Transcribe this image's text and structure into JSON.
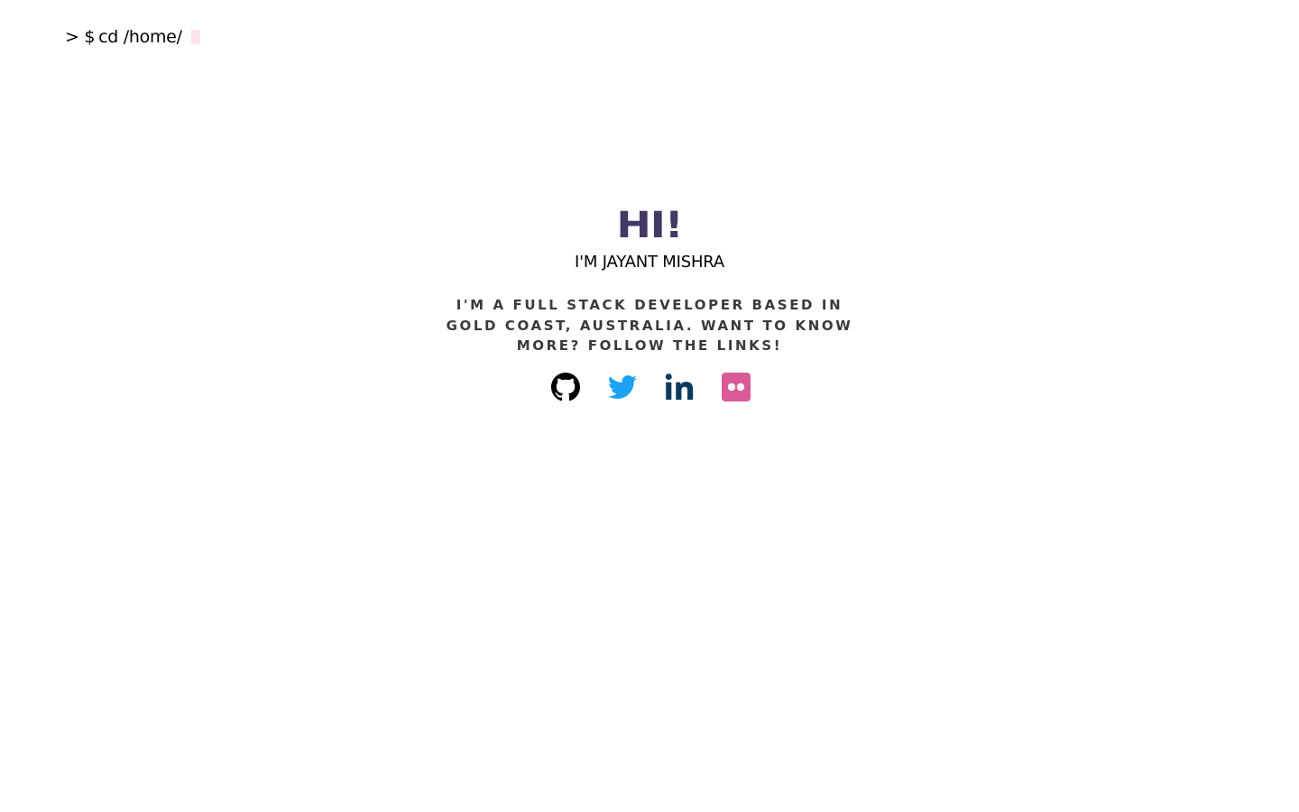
{
  "terminal": {
    "prompt": "> $",
    "command": "cd /home/"
  },
  "hero": {
    "greeting": "HI!",
    "name": "I'M JAYANT MISHRA",
    "tagline": "I'M A FULL STACK DEVELOPER BASED IN GOLD COAST, AUSTRALIA. WANT TO KNOW MORE? FOLLOW THE LINKS!"
  },
  "social": [
    {
      "icon": "github-icon",
      "color": "#000000"
    },
    {
      "icon": "twitter-icon",
      "color": "#1da1f2"
    },
    {
      "icon": "linkedin-icon",
      "color": "#0b3a5c"
    },
    {
      "icon": "flickr-icon",
      "color": "#d95a96"
    }
  ],
  "colors": {
    "accent": "#443865",
    "cursor": "#fce4ec"
  }
}
